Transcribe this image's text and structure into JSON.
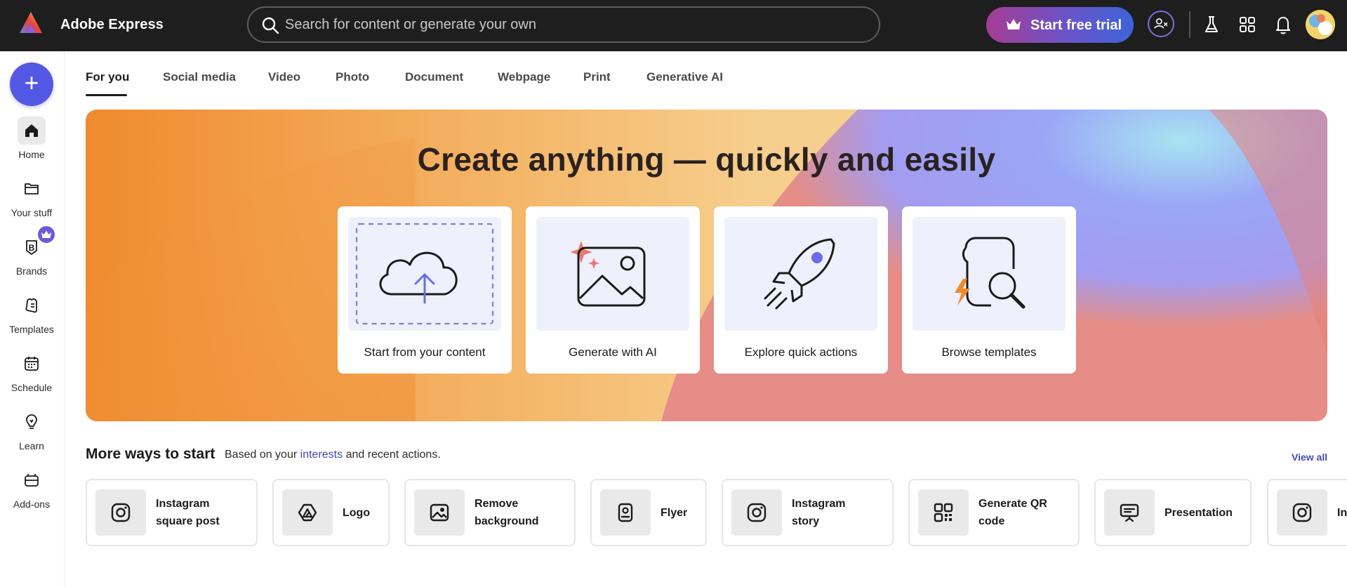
{
  "app": {
    "title": "Adobe Express"
  },
  "search": {
    "placeholder": "Search for content or generate your own"
  },
  "header": {
    "trial_label": "Start free trial"
  },
  "rail": {
    "create_symbol": "+",
    "items": [
      {
        "label": "Home",
        "icon": "home-icon"
      },
      {
        "label": "Your stuff",
        "icon": "folder-icon"
      },
      {
        "label": "Brands",
        "icon": "brand-icon"
      },
      {
        "label": "Templates",
        "icon": "templates-icon"
      },
      {
        "label": "Schedule",
        "icon": "calendar-icon"
      },
      {
        "label": "Learn",
        "icon": "lightbulb-icon"
      },
      {
        "label": "Add-ons",
        "icon": "addons-icon"
      }
    ]
  },
  "tabs": [
    {
      "label": "For you"
    },
    {
      "label": "Social media"
    },
    {
      "label": "Video"
    },
    {
      "label": "Photo"
    },
    {
      "label": "Document"
    },
    {
      "label": "Webpage"
    },
    {
      "label": "Print"
    },
    {
      "label": "Generative AI"
    }
  ],
  "hero": {
    "title": "Create anything — quickly and easily",
    "cards": [
      {
        "label": "Start from your content",
        "icon": "cloud-upload-icon"
      },
      {
        "label": "Generate with AI",
        "icon": "ai-image-icon"
      },
      {
        "label": "Explore quick actions",
        "icon": "rocket-icon"
      },
      {
        "label": "Browse templates",
        "icon": "template-search-icon"
      }
    ]
  },
  "more": {
    "title": "More ways to start",
    "subtitle_prefix": "Based on your",
    "subtitle_link": "interests",
    "subtitle_suffix": "and recent actions.",
    "view_all": "View all",
    "chips": [
      {
        "line1": "Instagram",
        "line2": "square post",
        "icon": "instagram-icon"
      },
      {
        "line1": "Logo",
        "line2": "",
        "icon": "logo-icon"
      },
      {
        "line1": "Remove",
        "line2": "background",
        "icon": "remove-background-icon"
      },
      {
        "line1": "Flyer",
        "line2": "",
        "icon": "flyer-icon"
      },
      {
        "line1": "Instagram",
        "line2": "story",
        "icon": "instagram-icon"
      },
      {
        "line1": "Generate QR",
        "line2": "code",
        "icon": "qr-code-icon"
      },
      {
        "line1": "Presentation",
        "line2": "",
        "icon": "presentation-icon"
      },
      {
        "line1": "In",
        "line2": "",
        "icon": "instagram-icon"
      }
    ]
  },
  "colors": {
    "topbar": "#1e1e1e",
    "accent": "#5258e4",
    "link": "#3d4ab8",
    "hero_orange": "#f0923a",
    "hero_purple": "#9aa3f5"
  }
}
